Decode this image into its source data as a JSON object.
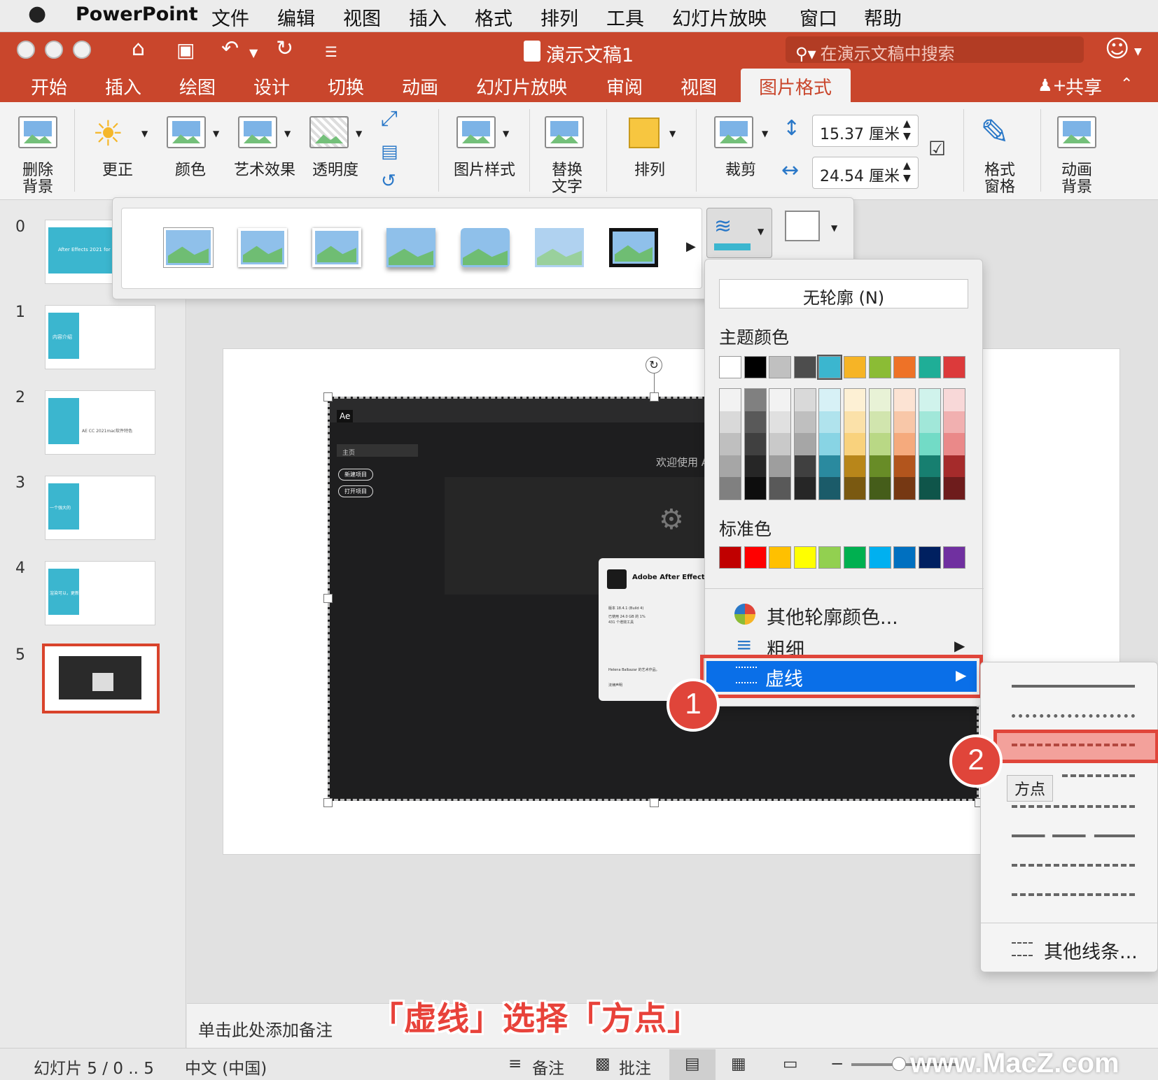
{
  "menubar": {
    "app_name": "PowerPoint",
    "items": [
      "文件",
      "编辑",
      "视图",
      "插入",
      "格式",
      "排列",
      "工具",
      "幻灯片放映",
      "窗口",
      "帮助"
    ]
  },
  "titlebar": {
    "doc_title": "演示文稿1",
    "search_placeholder": "在演示文稿中搜索"
  },
  "tabs": {
    "items": [
      "开始",
      "插入",
      "绘图",
      "设计",
      "切换",
      "动画",
      "幻灯片放映",
      "审阅",
      "视图"
    ],
    "active": "图片格式",
    "share": "共享"
  },
  "ribbon": {
    "remove_bg": "删除\n背景",
    "corrections": "更正",
    "color": "颜色",
    "artistic": "艺术效果",
    "transparency": "透明度",
    "picture_styles": "图片样式",
    "alt_text": "替换\n文字",
    "arrange": "排列",
    "crop": "裁剪",
    "height": "15.37 厘米",
    "width": "24.54 厘米",
    "format_pane": "格式\n窗格",
    "animate_bg": "动画\n背景"
  },
  "slides": [
    {
      "num": "0",
      "text": "After Effects 2021 for Mac(AE)"
    },
    {
      "num": "1",
      "text": "内容介绍"
    },
    {
      "num": "2",
      "text": "AE CC 2021mac软件特色"
    },
    {
      "num": "3",
      "text": "一个强大的"
    },
    {
      "num": "4",
      "text": "渲染可以，更新"
    },
    {
      "num": "5",
      "text": ""
    }
  ],
  "picture_content": {
    "ae_badge": "Ae",
    "home": "主页",
    "new_project": "新建项目",
    "open_project": "打开项目",
    "welcome": "欢迎使用 A",
    "about_title": "Adobe After Effects",
    "about_version": "版本 18.4.1 (Build 4)",
    "about_line2": "已使用 24.0 GB 的 1%",
    "about_line3": "431 个增效工具",
    "about_credit": "Helena Balbazar 的艺术作品。",
    "about_legal": "法律声明"
  },
  "outline_menu": {
    "no_outline": "无轮廓 (N)",
    "theme_colors": "主题颜色",
    "standard_colors": "标准色",
    "more_colors": "其他轮廓颜色...",
    "weight": "粗细",
    "dashes": "虚线",
    "theme_top": [
      "#ffffff",
      "#000000",
      "#c0c0c0",
      "#4d4d4d",
      "#3bb6cf",
      "#f6b426",
      "#8bbc35",
      "#ee7227",
      "#1fae97",
      "#dc3a3b"
    ],
    "theme_shades": [
      [
        "#f2f2f2",
        "#d9d9d9",
        "#bfbfbf",
        "#a6a6a6",
        "#808080"
      ],
      [
        "#808080",
        "#595959",
        "#404040",
        "#262626",
        "#0d0d0d"
      ],
      [
        "#f2f2f2",
        "#e0e0e0",
        "#c9c9c9",
        "#9e9e9e",
        "#595959"
      ],
      [
        "#d9d9d9",
        "#bfbfbf",
        "#a6a6a6",
        "#404040",
        "#262626"
      ],
      [
        "#d7f1f6",
        "#b0e3ed",
        "#88d4e4",
        "#2a8a9f",
        "#1b5b69"
      ],
      [
        "#fdf0d4",
        "#fbe1a9",
        "#f9d27d",
        "#b8861a",
        "#7a5911"
      ],
      [
        "#e8f2d6",
        "#d1e5ae",
        "#b9d885",
        "#688c27",
        "#455d1a"
      ],
      [
        "#fce3d3",
        "#f8c7a8",
        "#f5aa7d",
        "#b2551d",
        "#763813"
      ],
      [
        "#d0f3ec",
        "#a1e7d9",
        "#72dbc6",
        "#177f70",
        "#0f554a"
      ],
      [
        "#f8d8d8",
        "#f1b0b0",
        "#ea8989",
        "#a52b2b",
        "#6e1c1c"
      ]
    ],
    "standard": [
      "#c00000",
      "#ff0000",
      "#ffc000",
      "#ffff00",
      "#92d050",
      "#00b050",
      "#00b0f0",
      "#0070c0",
      "#002060",
      "#7030a0"
    ]
  },
  "dash_submenu": {
    "tooltip": "方点",
    "more_lines": "其他线条..."
  },
  "badges": {
    "one": "1",
    "two": "2"
  },
  "caption": "「虚线」选择「方点」",
  "notes_placeholder": "单击此处添加备注",
  "status": {
    "slide_info": "幻灯片 5 / 0 .. 5",
    "language": "中文 (中国)",
    "notes": "备注",
    "comments": "批注"
  },
  "watermark": "www.MacZ.com",
  "colors": {
    "brand": "#c9462c",
    "highlight": "#0a6fe8",
    "callout": "#e0453a"
  }
}
